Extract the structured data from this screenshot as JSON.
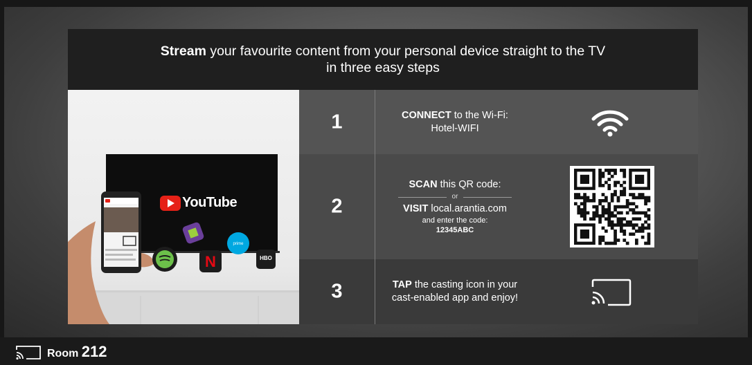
{
  "header": {
    "bold": "Stream",
    "line1_rest": " your favourite content from your personal device straight to the TV",
    "line2": "in three easy steps"
  },
  "photo": {
    "tv_brand": "YouTube",
    "app_icons": [
      "spotify-icon",
      "netflix-icon",
      "kodi-icon",
      "prime-video-icon",
      "hbo-now-icon"
    ]
  },
  "steps": [
    {
      "number": "1",
      "bold": "CONNECT",
      "text": " to the Wi-Fi:",
      "line2": "Hotel-WIFI",
      "icon": "wifi-icon"
    },
    {
      "number": "2",
      "bold": "SCAN",
      "text": " this QR code:",
      "or": "or",
      "bold2": "VISIT",
      "text2": " local.arantia.com",
      "line3": "and enter the code:",
      "code": "12345ABC",
      "icon": "qr-code"
    },
    {
      "number": "3",
      "bold": "TAP",
      "text": " the casting icon in your",
      "line2": "cast-enabled app and enjoy!",
      "icon": "cast-icon"
    }
  ],
  "footer": {
    "icon": "cast-icon",
    "room_label": "Room",
    "room_number": "212"
  },
  "colors": {
    "header_bg": "#1f1f1f",
    "step1_bg": "#545454",
    "step2_bg": "#4a4a4a",
    "step3_bg": "#3a3a3a",
    "youtube_red": "#e62117"
  }
}
